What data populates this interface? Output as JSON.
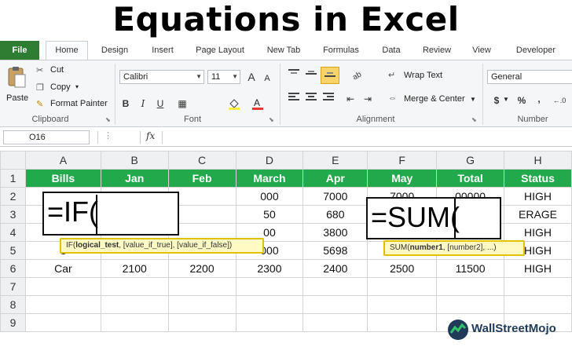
{
  "headline": "Equations in Excel",
  "colors": {
    "file_tab": "#2e7d32",
    "header_fill": "#22a94c",
    "tooltip_fill": "#fff9c4",
    "highlight": "#f7d36a"
  },
  "tabs": [
    "File",
    "Home",
    "Design",
    "Insert",
    "Page Layout",
    "New Tab",
    "Formulas",
    "Data",
    "Review",
    "View",
    "Developer"
  ],
  "ribbon": {
    "clipboard": {
      "paste": "Paste",
      "cut": "Cut",
      "copy": "Copy",
      "format_painter": "Format Painter",
      "title": "Clipboard"
    },
    "font": {
      "family": "Calibri",
      "size": "11",
      "grow": "A",
      "shrink": "A",
      "bold": "B",
      "italic": "I",
      "underline": "U",
      "title": "Font"
    },
    "alignment": {
      "wrap_text": "Wrap Text",
      "merge_center": "Merge & Center",
      "title": "Alignment"
    },
    "number": {
      "format": "General",
      "currency": "$",
      "percent": "%",
      "comma": ",",
      "title": "Number"
    }
  },
  "formula_bar": {
    "name_box": "O16",
    "fx": "fx"
  },
  "sheet": {
    "columns": [
      "A",
      "B",
      "C",
      "D",
      "E",
      "F",
      "G",
      "H"
    ],
    "row_numbers": [
      "1",
      "2",
      "3",
      "4",
      "5",
      "6",
      "7",
      "8",
      "9"
    ],
    "rows": [
      [
        "Bills",
        "Jan",
        "Feb",
        "March",
        "Apr",
        "May",
        "Total",
        "Status"
      ],
      [
        "",
        "",
        "",
        "000",
        "7000",
        "7000",
        "00000",
        "HIGH"
      ],
      [
        "I",
        "",
        "",
        "50",
        "680",
        "",
        "",
        "ERAGE"
      ],
      [
        "",
        "",
        "",
        "00",
        "3800",
        "",
        "",
        "HIGH"
      ],
      [
        "C",
        "",
        "",
        "000",
        "5698",
        "",
        "",
        "HIGH"
      ],
      [
        "Car",
        "2100",
        "2200",
        "2300",
        "2400",
        "2500",
        "11500",
        "HIGH"
      ],
      [
        "",
        "",
        "",
        "",
        "",
        "",
        "",
        ""
      ],
      [
        "",
        "",
        "",
        "",
        "",
        "",
        "",
        ""
      ],
      [
        "",
        "",
        "",
        "",
        "",
        "",
        "",
        ""
      ]
    ]
  },
  "overlays": {
    "if_edit": "=IF(",
    "if_tip": {
      "fn": "IF(",
      "bold": "logical_test",
      "rest": ", [value_if_true], [value_if_false])"
    },
    "sum_edit": "=SUM(",
    "sum_tip": {
      "fn": "SUM(",
      "bold": "number1",
      "rest": ", [number2], ...)"
    }
  },
  "logo": {
    "text": "WallStreetMojo",
    "icon": "wallstreetmojo-logo-icon"
  }
}
